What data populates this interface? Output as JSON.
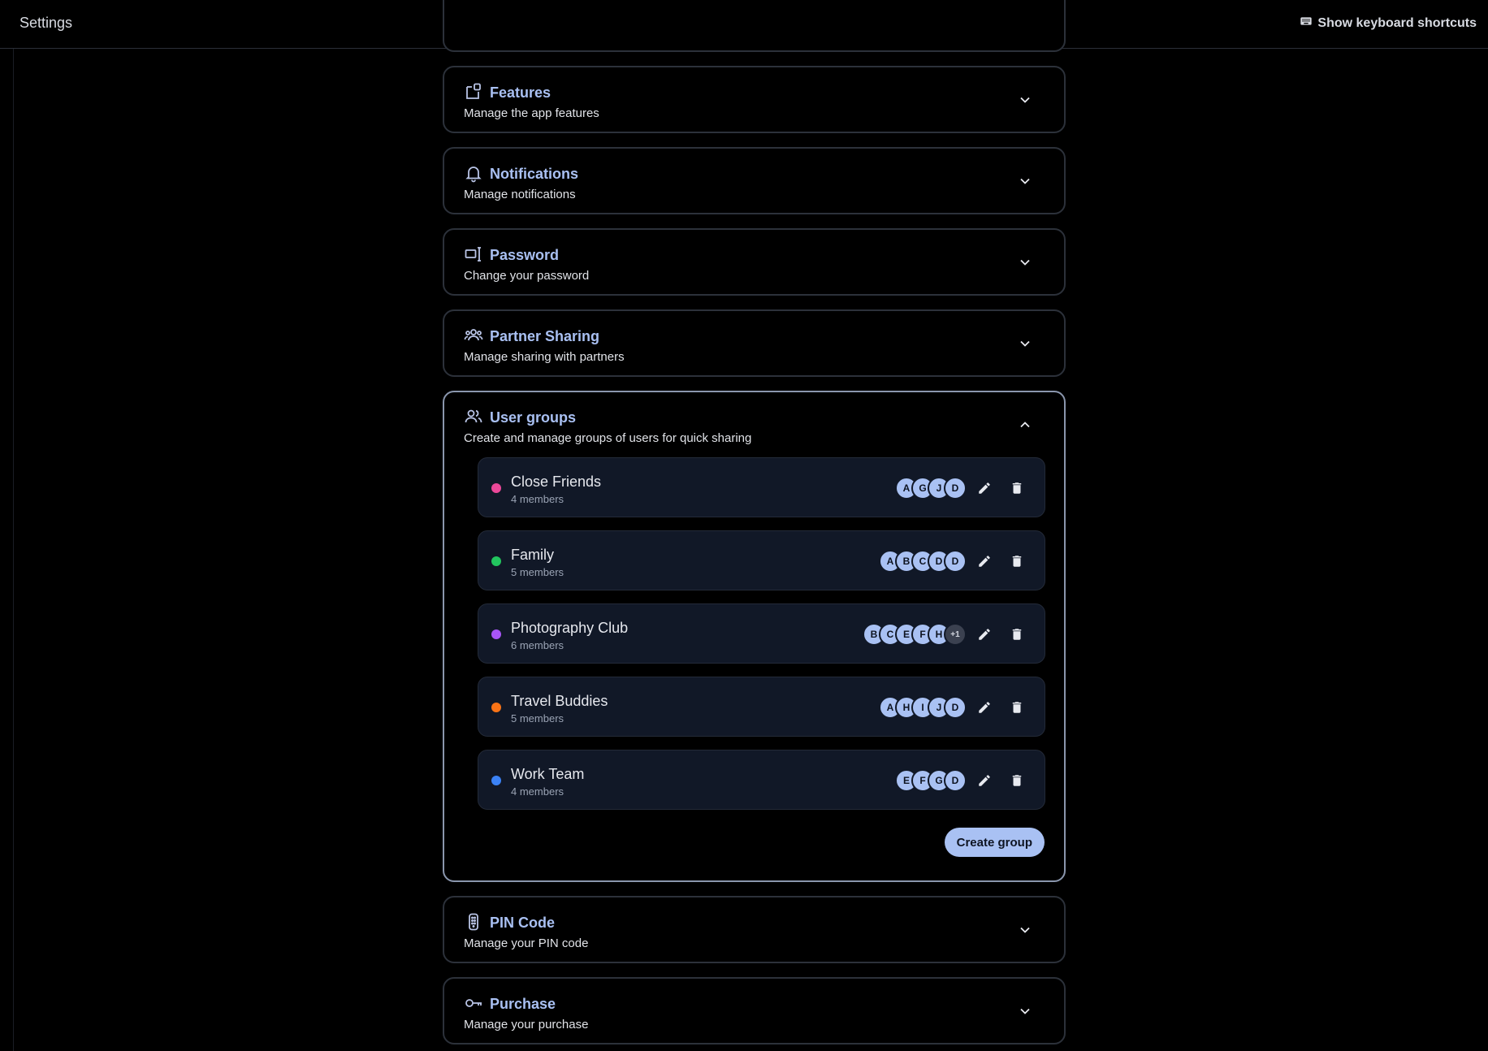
{
  "header": {
    "title": "Settings",
    "shortcuts_label": "Show keyboard shortcuts"
  },
  "panels": [
    {
      "title": "Features",
      "subtitle": "Manage the app features",
      "icon": "features-icon"
    },
    {
      "title": "Notifications",
      "subtitle": "Manage notifications",
      "icon": "bell-icon"
    },
    {
      "title": "Password",
      "subtitle": "Change your password",
      "icon": "password-icon"
    },
    {
      "title": "Partner Sharing",
      "subtitle": "Manage sharing with partners",
      "icon": "partner-icon"
    },
    {
      "title": "User groups",
      "subtitle": "Create and manage groups of users for quick sharing",
      "icon": "users-icon",
      "expanded": true
    },
    {
      "title": "PIN Code",
      "subtitle": "Manage your PIN code",
      "icon": "pin-icon"
    },
    {
      "title": "Purchase",
      "subtitle": "Manage your purchase",
      "icon": "key-icon"
    }
  ],
  "groups": [
    {
      "name": "Close Friends",
      "members": "4 members",
      "color": "#ec4899",
      "avatars": [
        "A",
        "G",
        "J",
        "D"
      ]
    },
    {
      "name": "Family",
      "members": "5 members",
      "color": "#22c55e",
      "avatars": [
        "A",
        "B",
        "C",
        "D",
        "D"
      ]
    },
    {
      "name": "Photography Club",
      "members": "6 members",
      "color": "#a855f7",
      "avatars": [
        "B",
        "C",
        "E",
        "F",
        "H"
      ],
      "more": "+1"
    },
    {
      "name": "Travel Buddies",
      "members": "5 members",
      "color": "#f97316",
      "avatars": [
        "A",
        "H",
        "I",
        "J",
        "D"
      ]
    },
    {
      "name": "Work Team",
      "members": "4 members",
      "color": "#3b82f6",
      "avatars": [
        "E",
        "F",
        "G",
        "D"
      ]
    }
  ],
  "create_group_label": "Create group"
}
